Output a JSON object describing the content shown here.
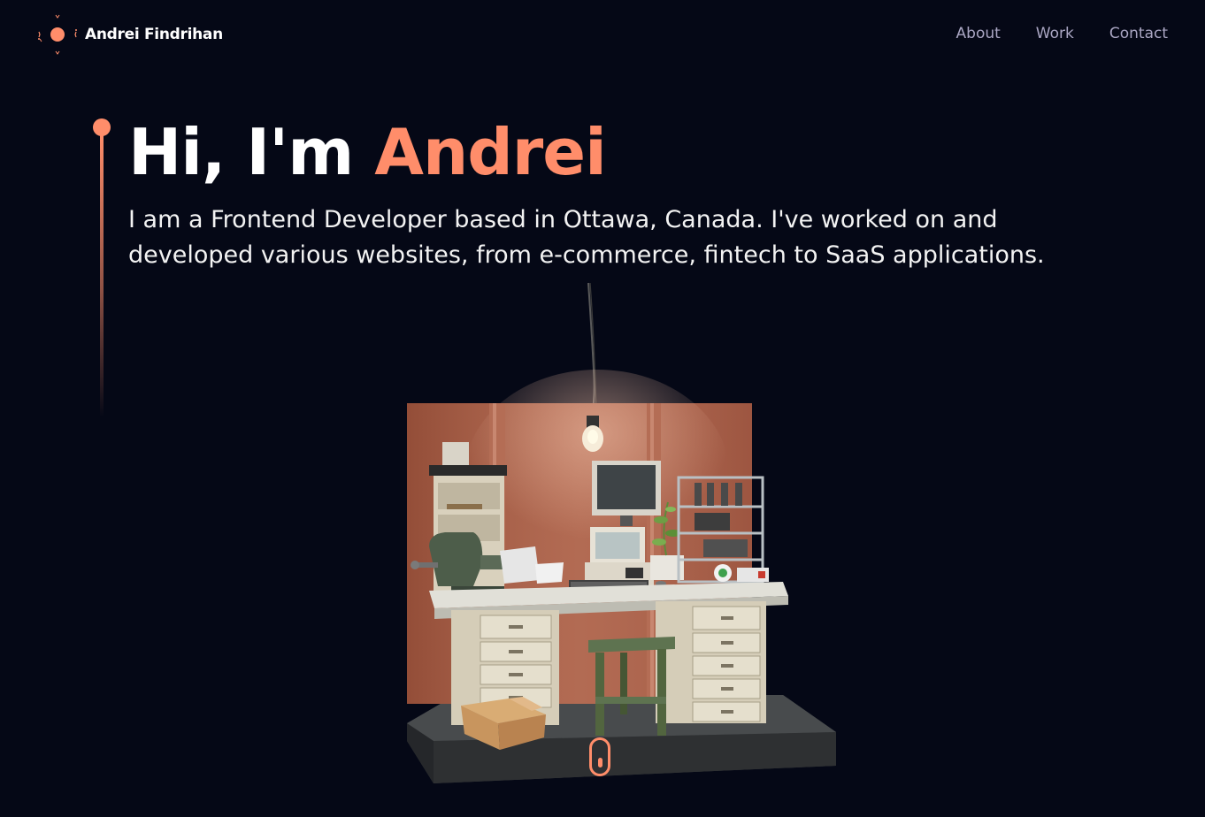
{
  "nav": {
    "brand_name": "Andrei Findrihan",
    "links": [
      "About",
      "Work",
      "Contact"
    ]
  },
  "hero": {
    "greeting": "Hi, I'm ",
    "name": "Andrei",
    "description": "I am a Frontend Developer based in Ottawa, Canada. I've worked on and developed various websites, from e-commerce, fintech to SaaS applications."
  },
  "colors": {
    "background": "#050816",
    "accent": "#ff8d6a",
    "nav_text": "#aaa6c3",
    "text": "#ffffff"
  },
  "icons": {
    "logo": "sun-logo-icon",
    "scroll": "mouse-scroll-icon"
  }
}
